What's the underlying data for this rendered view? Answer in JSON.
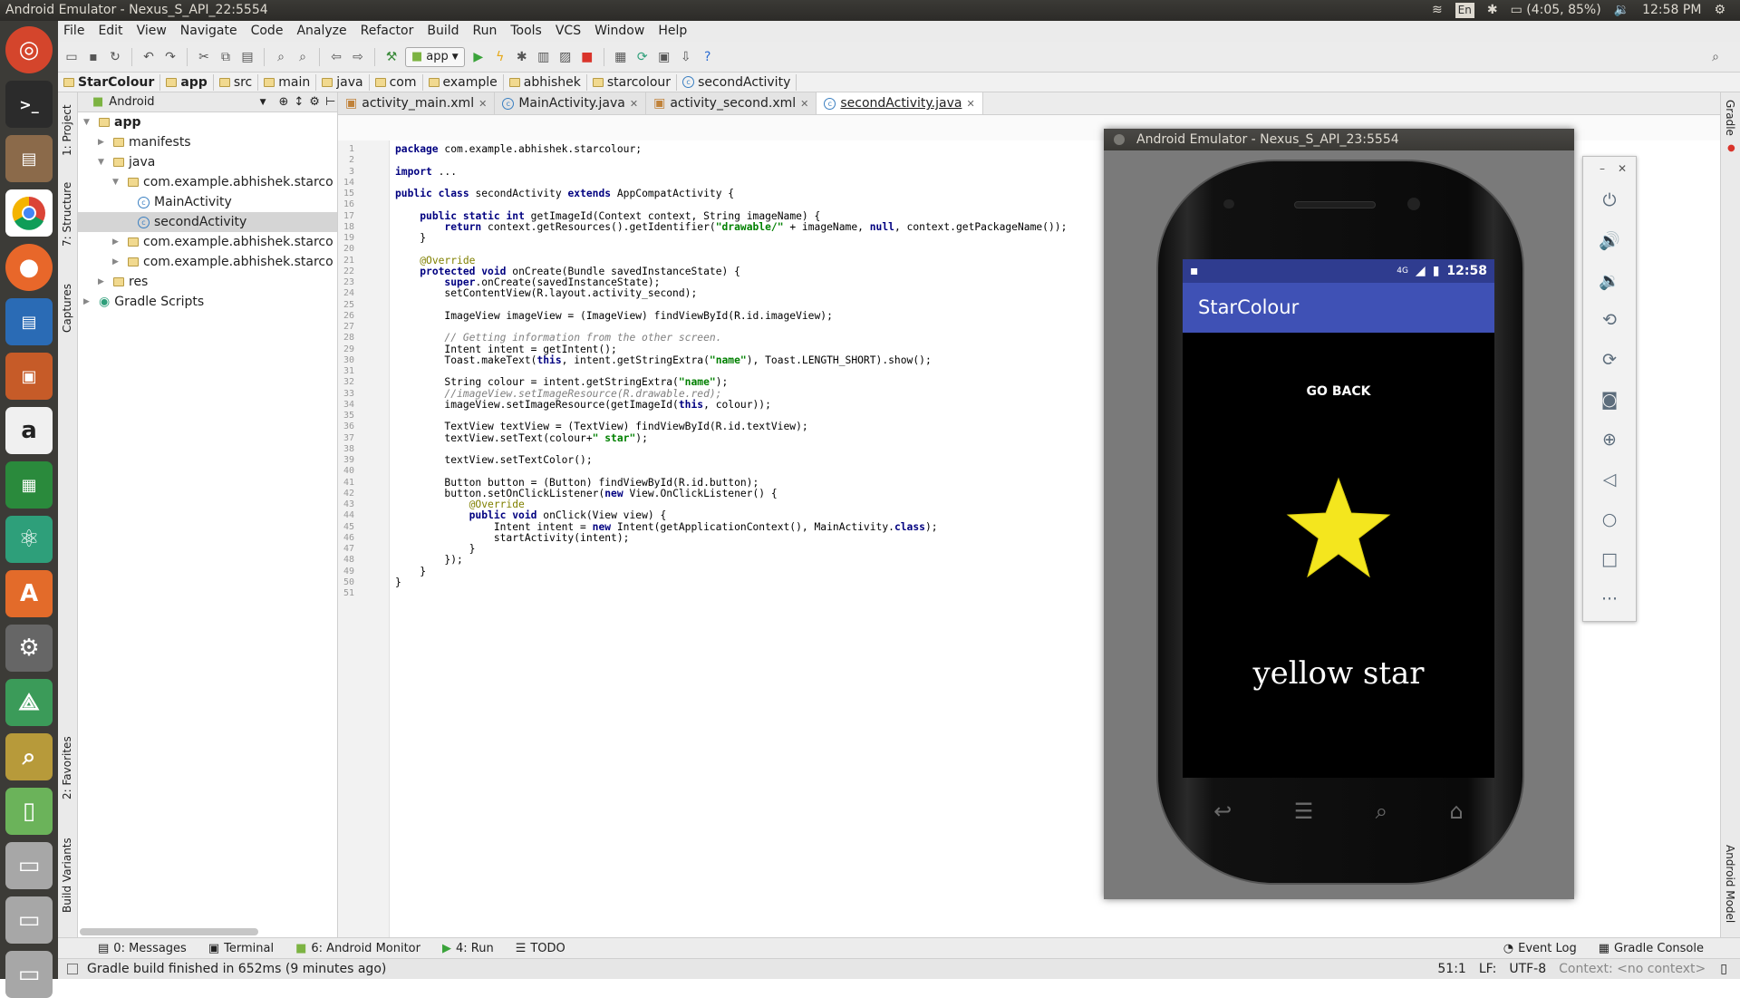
{
  "window": {
    "title": "Android Emulator - Nexus_S_API_22:5554"
  },
  "system": {
    "lang": "En",
    "battery": "(4:05, 85%)",
    "time": "12:58 PM"
  },
  "menu": [
    "File",
    "Edit",
    "View",
    "Navigate",
    "Code",
    "Analyze",
    "Refactor",
    "Build",
    "Run",
    "Tools",
    "VCS",
    "Window",
    "Help"
  ],
  "toolbar": {
    "run_config": "app"
  },
  "breadcrumb": [
    "StarColour",
    "app",
    "src",
    "main",
    "java",
    "com",
    "example",
    "abhishek",
    "starcolour",
    "secondActivity"
  ],
  "project": {
    "view_mode": "Android",
    "tree": [
      {
        "label": "app",
        "level": 0
      },
      {
        "label": "manifests",
        "level": 1
      },
      {
        "label": "java",
        "level": 1
      },
      {
        "label": "com.example.abhishek.starco",
        "level": 2
      },
      {
        "label": "MainActivity",
        "level": 3
      },
      {
        "label": "secondActivity",
        "level": 3
      },
      {
        "label": "com.example.abhishek.starco",
        "level": 2
      },
      {
        "label": "com.example.abhishek.starco",
        "level": 2
      },
      {
        "label": "res",
        "level": 1
      },
      {
        "label": "Gradle Scripts",
        "level": 0
      }
    ]
  },
  "tabs": [
    "activity_main.xml",
    "MainActivity.java",
    "activity_second.xml",
    "secondActivity.java"
  ],
  "side_tabs": {
    "project": "1: Project",
    "structure": "7: Structure",
    "captures": "Captures",
    "favorites": "2: Favorites",
    "build_variants": "Build Variants",
    "gradle": "Gradle",
    "android_model": "Android Model"
  },
  "code": [
    {
      "n": "1",
      "t": "package com.example.abhishek.starcolour;"
    },
    {
      "n": "2",
      "t": ""
    },
    {
      "n": "3",
      "t": "import ..."
    },
    {
      "n": "14",
      "t": ""
    },
    {
      "n": "15",
      "t": "public class secondActivity extends AppCompatActivity {"
    },
    {
      "n": "16",
      "t": ""
    },
    {
      "n": "17",
      "t": "    public static int getImageId(Context context, String imageName) {"
    },
    {
      "n": "18",
      "t": "        return context.getResources().getIdentifier(\"drawable/\" + imageName, null, context.getPackageName());"
    },
    {
      "n": "19",
      "t": "    }"
    },
    {
      "n": "20",
      "t": ""
    },
    {
      "n": "21",
      "t": "    @Override"
    },
    {
      "n": "22",
      "t": "    protected void onCreate(Bundle savedInstanceState) {"
    },
    {
      "n": "23",
      "t": "        super.onCreate(savedInstanceState);"
    },
    {
      "n": "24",
      "t": "        setContentView(R.layout.activity_second);"
    },
    {
      "n": "25",
      "t": ""
    },
    {
      "n": "26",
      "t": "        ImageView imageView = (ImageView) findViewById(R.id.imageView);"
    },
    {
      "n": "27",
      "t": ""
    },
    {
      "n": "28",
      "t": "        // Getting information from the other screen."
    },
    {
      "n": "29",
      "t": "        Intent intent = getIntent();"
    },
    {
      "n": "30",
      "t": "        Toast.makeText(this, intent.getStringExtra(\"name\"), Toast.LENGTH_SHORT).show();"
    },
    {
      "n": "31",
      "t": ""
    },
    {
      "n": "32",
      "t": "        String colour = intent.getStringExtra(\"name\");"
    },
    {
      "n": "33",
      "t": "        //imageView.setImageResource(R.drawable.red);"
    },
    {
      "n": "34",
      "t": "        imageView.setImageResource(getImageId(this, colour));"
    },
    {
      "n": "35",
      "t": ""
    },
    {
      "n": "36",
      "t": "        TextView textView = (TextView) findViewById(R.id.textView);"
    },
    {
      "n": "37",
      "t": "        textView.setText(colour+\" star\");"
    },
    {
      "n": "38",
      "t": ""
    },
    {
      "n": "39",
      "t": "        textView.setTextColor();"
    },
    {
      "n": "40",
      "t": ""
    },
    {
      "n": "41",
      "t": "        Button button = (Button) findViewById(R.id.button);"
    },
    {
      "n": "42",
      "t": "        button.setOnClickListener(new View.OnClickListener() {"
    },
    {
      "n": "43",
      "t": "            @Override"
    },
    {
      "n": "44",
      "t": "            public void onClick(View view) {"
    },
    {
      "n": "45",
      "t": "                Intent intent = new Intent(getApplicationContext(), MainActivity.class);"
    },
    {
      "n": "46",
      "t": "                startActivity(intent);"
    },
    {
      "n": "47",
      "t": "            }"
    },
    {
      "n": "48",
      "t": "        });"
    },
    {
      "n": "49",
      "t": "    }"
    },
    {
      "n": "50",
      "t": "}"
    },
    {
      "n": "51",
      "t": ""
    }
  ],
  "emulator": {
    "title": "Android Emulator - Nexus_S_API_23:5554",
    "status_time": "12:58",
    "network": "4G",
    "app_title": "StarColour",
    "button": "GO BACK",
    "star_text": "yellow star",
    "star_color": "#f4e61e"
  },
  "bottom_tabs": [
    "0: Messages",
    "Terminal",
    "6: Android Monitor",
    "4: Run",
    "TODO",
    "Event Log",
    "Gradle Console"
  ],
  "status": {
    "message": "Gradle build finished in 652ms (9 minutes ago)",
    "position": "51:1",
    "line_sep": "LF:",
    "encoding": "UTF-8",
    "context": "Context: <no context>"
  },
  "colors": {
    "accent": "#3f51b5",
    "statusbar": "#2f3c8f"
  }
}
